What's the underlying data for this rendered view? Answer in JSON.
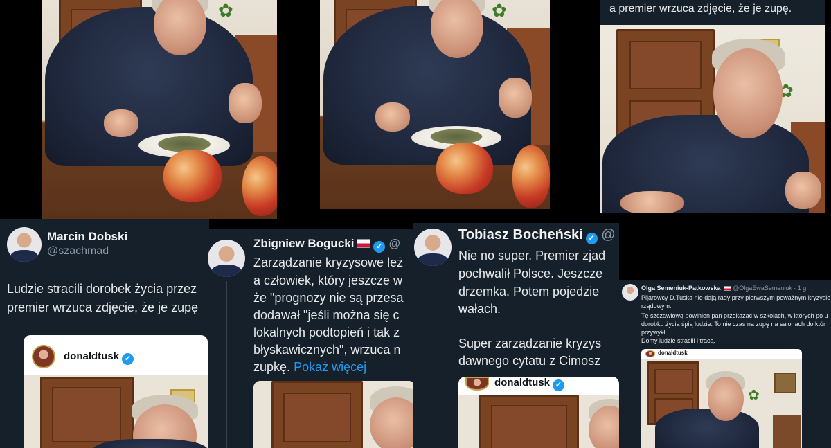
{
  "photos": {
    "top_caption": "a premier wrzuca zdjęcie, że je zupę."
  },
  "tweets": [
    {
      "name": "Marcin Dobski",
      "handle": "@szachmad",
      "lines": [
        "Ludzie stracili dorobek życia przez",
        "premier wrzuca zdjęcie, że je zupę"
      ],
      "embed_name": "donaldtusk"
    },
    {
      "name": "Zbigniew Bogucki",
      "handle": "@",
      "lines": [
        "Zarządzanie kryzysowe leż",
        "a człowiek, który jeszcze w",
        "że \"prognozy nie są przesa",
        "dodawał \"jeśli można się c",
        "lokalnych podtopień i tak z",
        "błyskawicznych\", wrzuca n"
      ],
      "last_line": "zupkę.",
      "more": "Pokaż więcej"
    },
    {
      "name": "Tobiasz Bocheński",
      "handle": "@",
      "lines": [
        "Nie no super. Premier zjad",
        "pochwalił Polsce. Jeszcze",
        "drzemka. Potem pojedzie",
        "wałach.",
        "",
        "Super zarządzanie kryzys",
        "dawnego cytatu z Cimosz"
      ],
      "embed_name": "donaldtusk"
    },
    {
      "name": "Olga Semeniuk-Patkowska",
      "handle": "@OlgaEwaSemeniuk · 1 g.",
      "lines": [
        "Pijarowcy D.Tuska nie dają rady przy pierwszym poważnym kryzysie",
        "rządowym.",
        "Tę szczawiową powinien pan przekazać w szkołach, w których po u",
        "dorobku życia śpią ludzie. To nie czas na zupę na salonach do któr",
        "przywykł...",
        "Domy ludzie stracili i tracą."
      ],
      "embed_name": "donaldtusk"
    }
  ]
}
